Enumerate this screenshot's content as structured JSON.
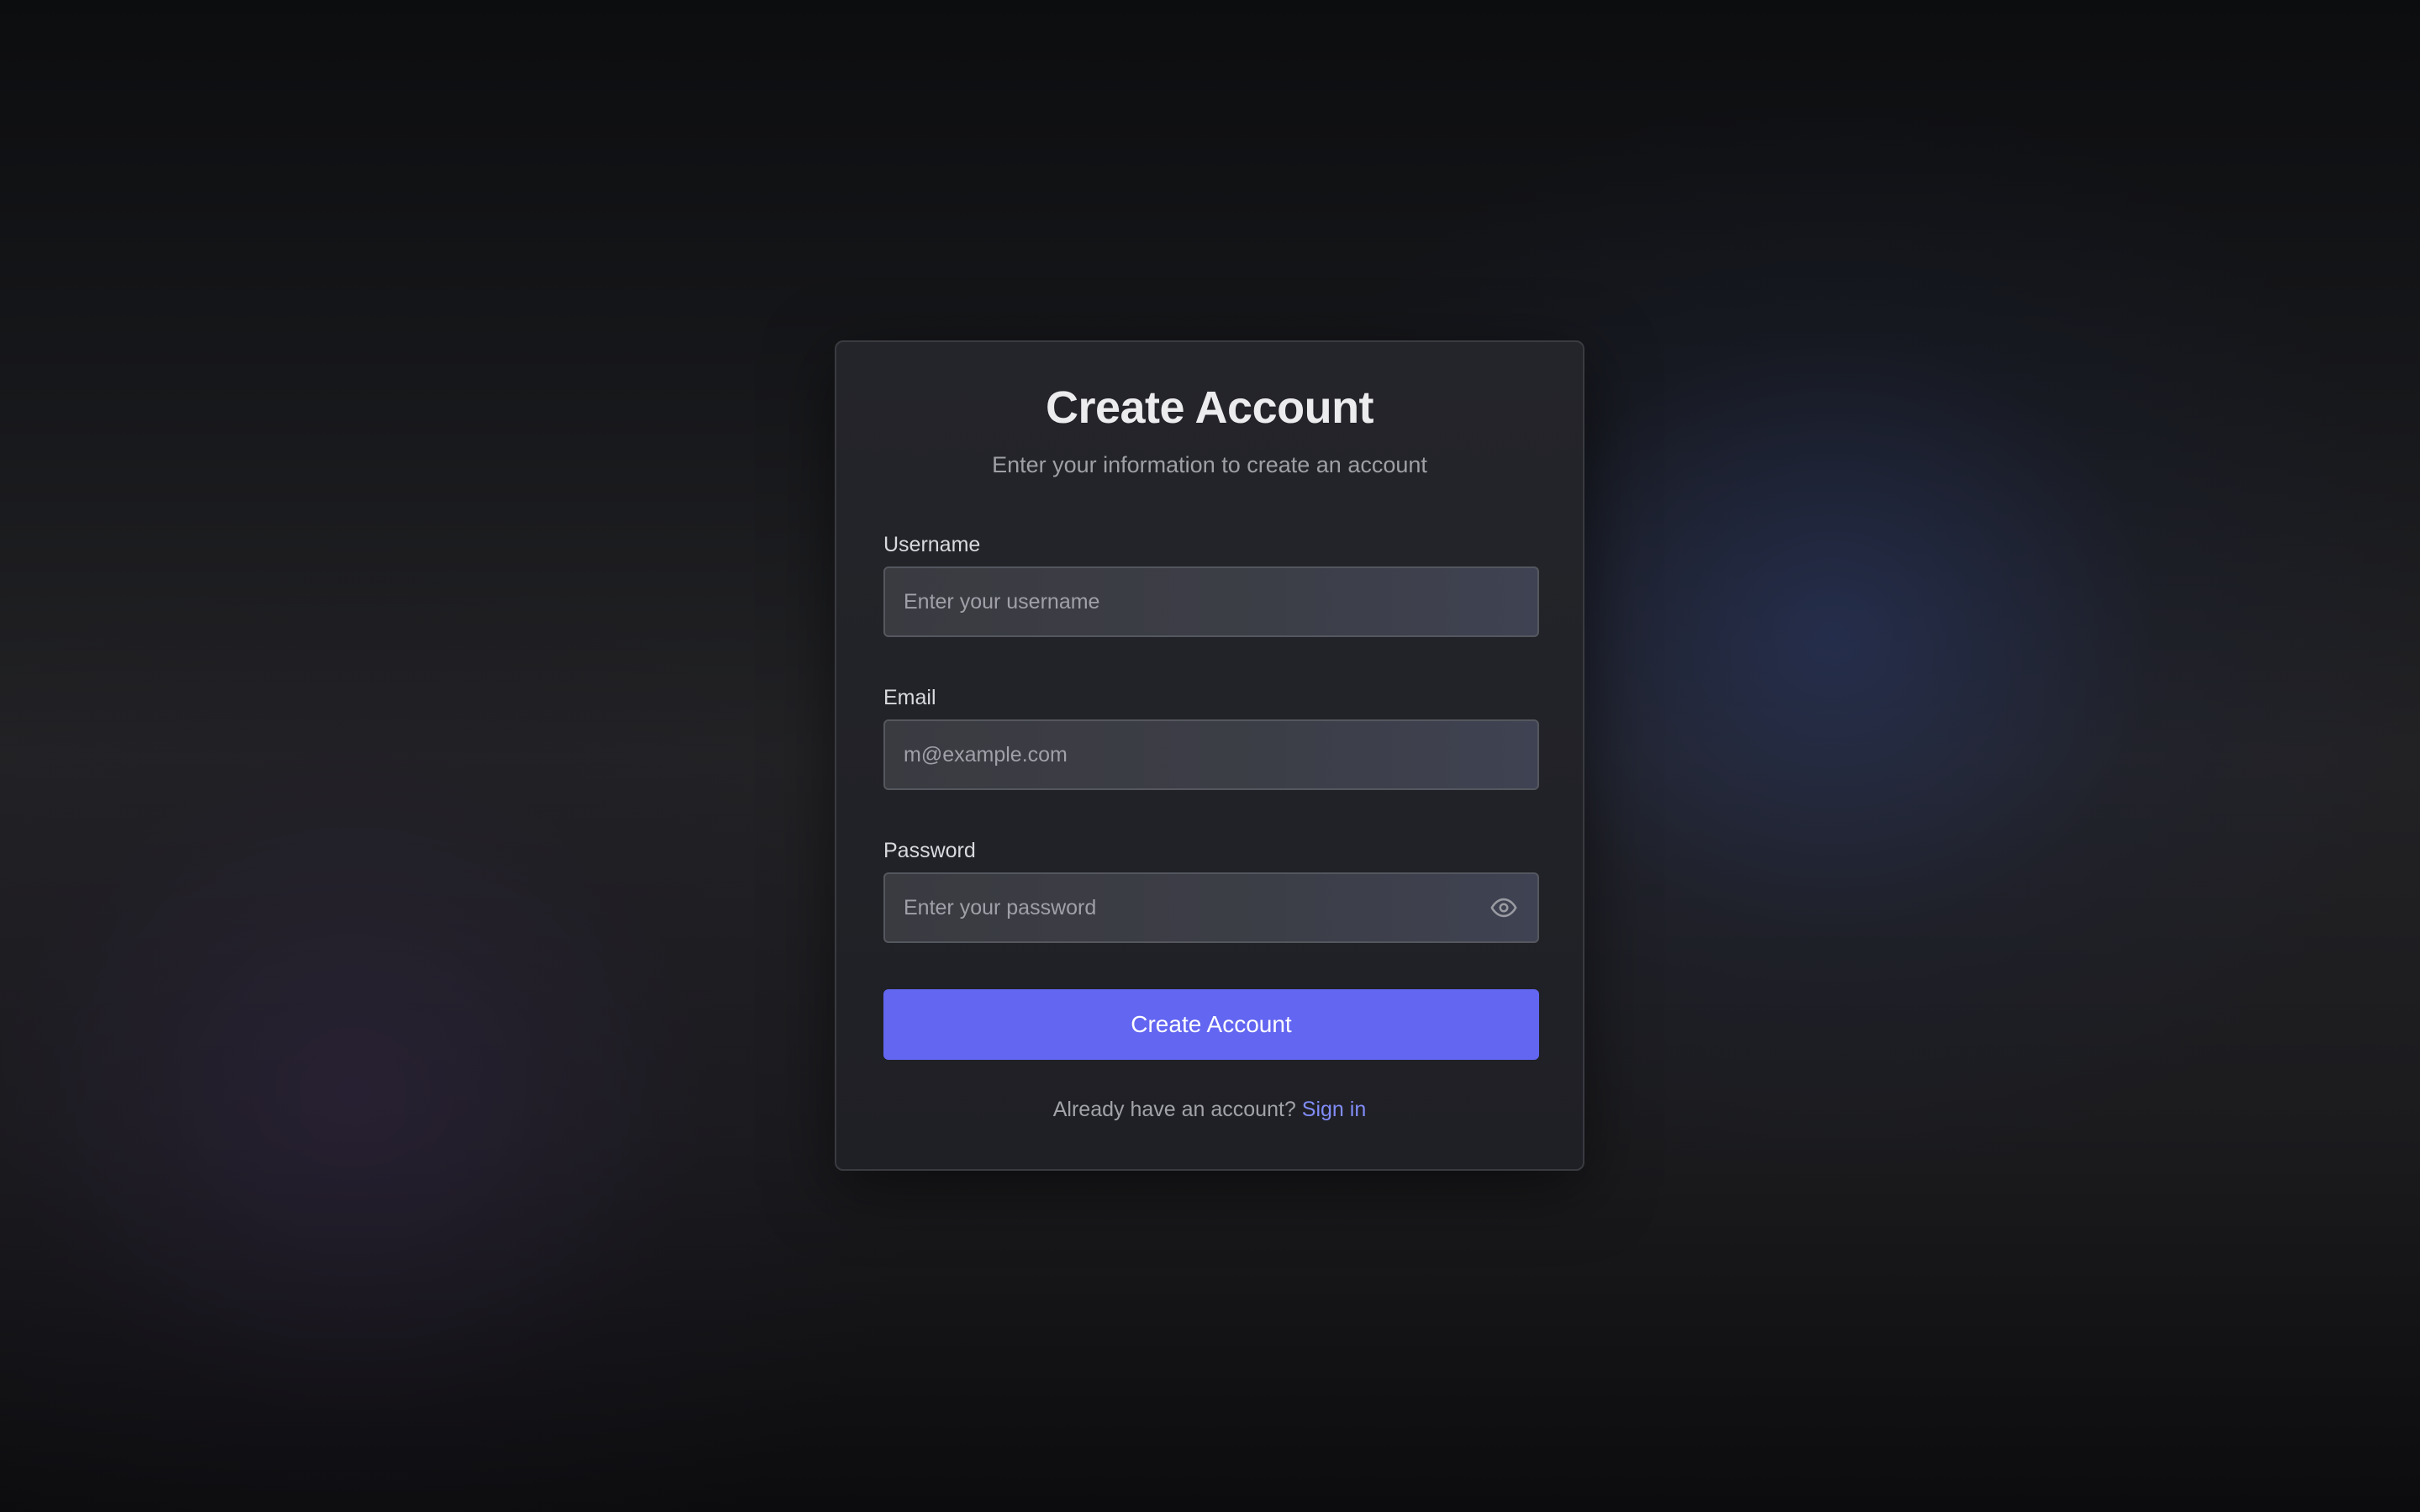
{
  "header": {
    "title": "Create Account",
    "subtitle": "Enter your information to create an account"
  },
  "form": {
    "username": {
      "label": "Username",
      "placeholder": "Enter your username",
      "value": ""
    },
    "email": {
      "label": "Email",
      "placeholder": "m@example.com",
      "value": ""
    },
    "password": {
      "label": "Password",
      "placeholder": "Enter your password",
      "value": "",
      "toggle_icon": "eye-icon"
    },
    "submit_label": "Create Account"
  },
  "footer": {
    "prompt": "Already have an account?",
    "link_label": "Sign in"
  },
  "colors": {
    "accent": "#6366f1",
    "link": "#818cf8",
    "card_border": "#3a3b41",
    "background": "#0d0e10"
  }
}
